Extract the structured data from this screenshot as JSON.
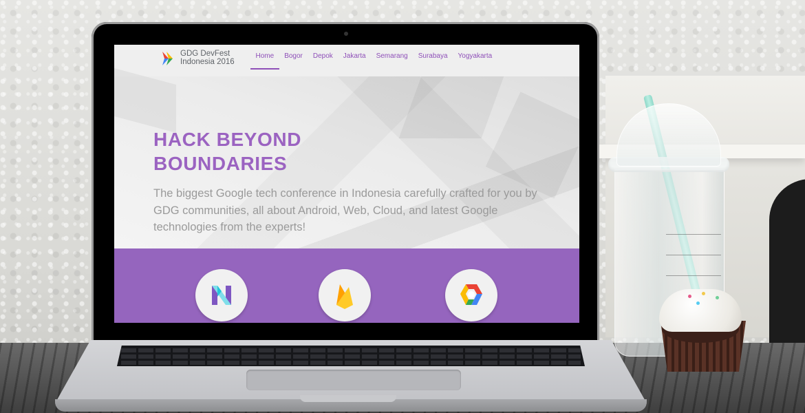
{
  "site": {
    "brand_line1": "GDG DevFest",
    "brand_line2": "Indonesia 2016"
  },
  "nav": {
    "items": [
      {
        "label": "Home",
        "active": true
      },
      {
        "label": "Bogor",
        "active": false
      },
      {
        "label": "Depok",
        "active": false
      },
      {
        "label": "Jakarta",
        "active": false
      },
      {
        "label": "Semarang",
        "active": false
      },
      {
        "label": "Surabaya",
        "active": false
      },
      {
        "label": "Yogyakarta",
        "active": false
      }
    ]
  },
  "hero": {
    "title_line1": "HACK BEYOND",
    "title_line2": "BOUNDARIES",
    "description": "The biggest Google tech conference in Indonesia carefully crafted for you by GDG communities, all about Android, Web, Cloud, and latest Google technologies from the experts!"
  },
  "tech_icons": [
    "android-nougat-icon",
    "firebase-icon",
    "google-cloud-icon"
  ],
  "colors": {
    "accent": "#9b63c1",
    "band": "#9565be",
    "nav_link": "#8e4fb8"
  }
}
